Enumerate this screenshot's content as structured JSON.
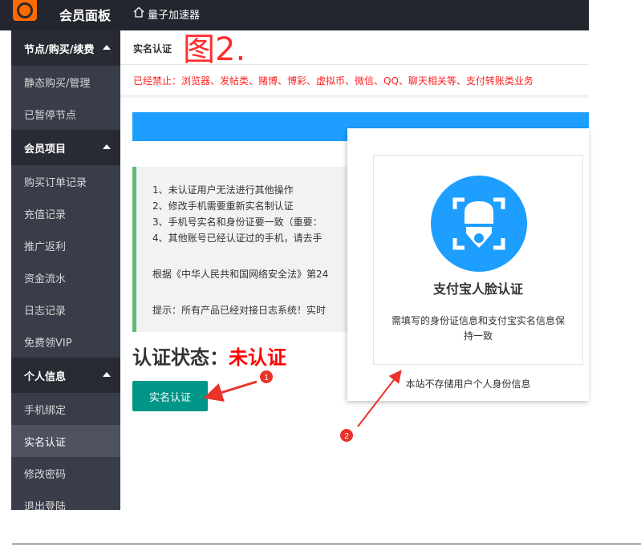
{
  "topbar": {
    "app_title": "会员面板",
    "home_label": "量子加速器"
  },
  "sidebar": {
    "groups": [
      {
        "label": "节点/购买/续费",
        "items": [
          "静态购买/管理",
          "已暂停节点"
        ]
      },
      {
        "label": "会员项目",
        "items": [
          "购买订单记录",
          "充值记录",
          "推广返利",
          "资金流水",
          "日志记录",
          "免费领VIP"
        ]
      },
      {
        "label": "个人信息",
        "items": [
          "手机绑定",
          "实名认证",
          "修改密码",
          "退出登陆"
        ]
      }
    ],
    "active_item": "实名认证"
  },
  "panel": {
    "title": "实名认证",
    "figure_label": "图2.",
    "warning": "已经禁止：浏览器、发帖类、赌博、博彩、虚拟币、微信、QQ、聊天相关等、支付转账类业务"
  },
  "notice": {
    "lines": [
      "1、未认证用户无法进行其他操作",
      "2、修改手机需要重新实名制认证",
      "3、手机号实名和身份证要一致（重要：",
      "4、其他账号已经认证过的手机，请去手"
    ],
    "law_line": "根据《中华人民共和国网络安全法》第24",
    "tip_line": "提示：所有产品已经对接日志系统！实时"
  },
  "status": {
    "label": "认证状态：",
    "value": "未认证"
  },
  "verify_button": "实名认证",
  "popup": {
    "card_title": "支付宝人脸认证",
    "card_desc": "需填写的身份证信息和支付宝实名信息保持一致",
    "note": "本站不存储用户个人身份信息"
  },
  "annotations": {
    "marker_1": "1",
    "marker_2": "2"
  },
  "colors": {
    "accent_blue": "#1e9fff",
    "teal": "#009688",
    "warning_red": "#ff1f1f",
    "annotation_red": "#e8322a"
  }
}
